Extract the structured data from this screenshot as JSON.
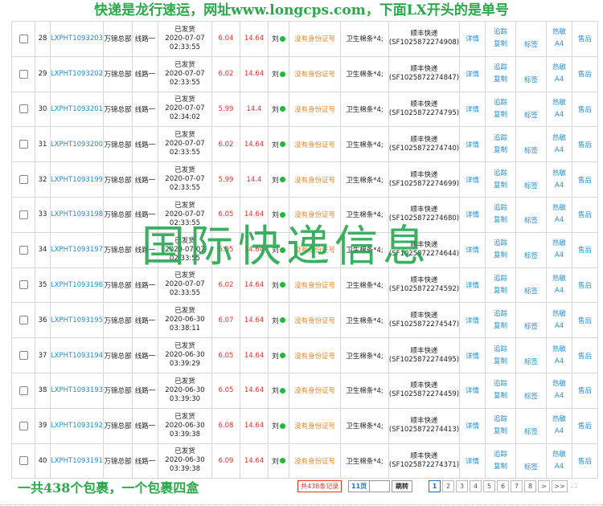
{
  "banner": "快递是龙行速运，网址www.longcps.com，下面LX开头的是单号",
  "watermark": "国际快递信息",
  "rows": [
    {
      "no": "28",
      "order": "LXPHT1093203",
      "dept": "万锦总部",
      "line": "线路一",
      "status": "已发货",
      "date": "2020-07-07",
      "time": "02:33:55",
      "weight": "6.04",
      "fee": "14.64",
      "recv": "刘",
      "id_note": "没有身份证号",
      "goods": "卫生棉条*4;",
      "carrier": "顺丰快递",
      "tracking": "(SF1025872274908)",
      "detail": "详情",
      "track": "追踪",
      "copy": "复制",
      "tag": "标签",
      "printer": "热敏",
      "paper": "A4",
      "after": "售后"
    },
    {
      "no": "29",
      "order": "LXPHT1093202",
      "dept": "万锦总部",
      "line": "线路一",
      "status": "已发货",
      "date": "2020-07-07",
      "time": "02:33:55",
      "weight": "6.02",
      "fee": "14.64",
      "recv": "刘",
      "id_note": "没有身份证号",
      "goods": "卫生棉条*4;",
      "carrier": "顺丰快递",
      "tracking": "(SF1025872274847)",
      "detail": "详情",
      "track": "追踪",
      "copy": "复制",
      "tag": "标签",
      "printer": "热敏",
      "paper": "A4",
      "after": "售后"
    },
    {
      "no": "30",
      "order": "LXPHT1093201",
      "dept": "万锦总部",
      "line": "线路一",
      "status": "已发货",
      "date": "2020-07-07",
      "time": "02:34:02",
      "weight": "5.99",
      "fee": "14.4",
      "recv": "刘",
      "id_note": "没有身份证号",
      "goods": "卫生棉条*4;",
      "carrier": "顺丰快递",
      "tracking": "(SF1025872274795)",
      "detail": "详情",
      "track": "追踪",
      "copy": "复制",
      "tag": "标签",
      "printer": "热敏",
      "paper": "A4",
      "after": "售后"
    },
    {
      "no": "31",
      "order": "LXPHT1093200",
      "dept": "万锦总部",
      "line": "线路一",
      "status": "已发货",
      "date": "2020-07-07",
      "time": "02:33:55",
      "weight": "6.02",
      "fee": "14.64",
      "recv": "刘",
      "id_note": "没有身份证号",
      "goods": "卫生棉条*4;",
      "carrier": "顺丰快递",
      "tracking": "(SF1025872274740)",
      "detail": "详情",
      "track": "追踪",
      "copy": "复制",
      "tag": "标签",
      "printer": "热敏",
      "paper": "A4",
      "after": "售后"
    },
    {
      "no": "32",
      "order": "LXPHT1093199",
      "dept": "万锦总部",
      "line": "线路一",
      "status": "已发货",
      "date": "2020-07-07",
      "time": "02:33:55",
      "weight": "5.99",
      "fee": "14.4",
      "recv": "刘",
      "id_note": "没有身份证号",
      "goods": "卫生棉条*4;",
      "carrier": "顺丰快递",
      "tracking": "(SF1025872274699)",
      "detail": "详情",
      "track": "追踪",
      "copy": "复制",
      "tag": "标签",
      "printer": "热敏",
      "paper": "A4",
      "after": "售后"
    },
    {
      "no": "33",
      "order": "LXPHT1093198",
      "dept": "万锦总部",
      "line": "线路一",
      "status": "已发货",
      "date": "2020-07-07",
      "time": "02:33:55",
      "weight": "6.05",
      "fee": "14.64",
      "recv": "刘",
      "id_note": "没有身份证号",
      "goods": "卫生棉条*4;",
      "carrier": "顺丰快递",
      "tracking": "(SF1025872274680)",
      "detail": "详情",
      "track": "追踪",
      "copy": "复制",
      "tag": "标签",
      "printer": "热敏",
      "paper": "A4",
      "after": "售后"
    },
    {
      "no": "34",
      "order": "LXPHT1093197",
      "dept": "万锦总部",
      "line": "线路一",
      "status": "已发货",
      "date": "2020-07-07",
      "time": "02:33:55",
      "weight": "6.05",
      "fee": "14.64",
      "recv": "刘",
      "id_note": "没有身份证号",
      "goods": "卫生棉条*4;",
      "carrier": "顺丰快递",
      "tracking": "(SF1025872274644)",
      "detail": "详情",
      "track": "追踪",
      "copy": "复制",
      "tag": "标签",
      "printer": "热敏",
      "paper": "A4",
      "after": "售后"
    },
    {
      "no": "35",
      "order": "LXPHT1093196",
      "dept": "万锦总部",
      "line": "线路一",
      "status": "已发货",
      "date": "2020-07-07",
      "time": "02:33:55",
      "weight": "6.02",
      "fee": "14.64",
      "recv": "刘",
      "id_note": "没有身份证号",
      "goods": "卫生棉条*4;",
      "carrier": "顺丰快递",
      "tracking": "(SF1025872274592)",
      "detail": "详情",
      "track": "追踪",
      "copy": "复制",
      "tag": "标签",
      "printer": "热敏",
      "paper": "A4",
      "after": "售后"
    },
    {
      "no": "36",
      "order": "LXPHT1093195",
      "dept": "万锦总部",
      "line": "线路一",
      "status": "已发货",
      "date": "2020-06-30",
      "time": "03:38:11",
      "weight": "6.07",
      "fee": "14.64",
      "recv": "刘",
      "id_note": "没有身份证号",
      "goods": "卫生棉条*4;",
      "carrier": "顺丰快递",
      "tracking": "(SF1025872274547)",
      "detail": "详情",
      "track": "追踪",
      "copy": "复制",
      "tag": "标签",
      "printer": "热敏",
      "paper": "A4",
      "after": "售后"
    },
    {
      "no": "37",
      "order": "LXPHT1093194",
      "dept": "万锦总部",
      "line": "线路一",
      "status": "已发货",
      "date": "2020-06-30",
      "time": "03:39:29",
      "weight": "6.05",
      "fee": "14.64",
      "recv": "刘",
      "id_note": "没有身份证号",
      "goods": "卫生棉条*4;",
      "carrier": "顺丰快递",
      "tracking": "(SF1025872274495)",
      "detail": "详情",
      "track": "追踪",
      "copy": "复制",
      "tag": "标签",
      "printer": "热敏",
      "paper": "A4",
      "after": "售后"
    },
    {
      "no": "38",
      "order": "LXPHT1093193",
      "dept": "万锦总部",
      "line": "线路一",
      "status": "已发货",
      "date": "2020-06-30",
      "time": "03:39:30",
      "weight": "6.05",
      "fee": "14.64",
      "recv": "刘",
      "id_note": "没有身份证号",
      "goods": "卫生棉条*4;",
      "carrier": "顺丰快递",
      "tracking": "(SF1025872274459)",
      "detail": "详情",
      "track": "追踪",
      "copy": "复制",
      "tag": "标签",
      "printer": "热敏",
      "paper": "A4",
      "after": "售后"
    },
    {
      "no": "39",
      "order": "LXPHT1093192",
      "dept": "万锦总部",
      "line": "线路一",
      "status": "已发货",
      "date": "2020-06-30",
      "time": "03:39:38",
      "weight": "6.08",
      "fee": "14.64",
      "recv": "刘",
      "id_note": "没有身份证号",
      "goods": "卫生棉条*4;",
      "carrier": "顺丰快递",
      "tracking": "(SF1025872274413)",
      "detail": "详情",
      "track": "追踪",
      "copy": "复制",
      "tag": "标签",
      "printer": "热敏",
      "paper": "A4",
      "after": "售后"
    },
    {
      "no": "40",
      "order": "LXPHT1093191",
      "dept": "万锦总部",
      "line": "线路一",
      "status": "已发货",
      "date": "2020-06-30",
      "time": "03:39:38",
      "weight": "6.09",
      "fee": "14.64",
      "recv": "刘",
      "id_note": "没有身份证号",
      "goods": "卫生棉条*4;",
      "carrier": "顺丰快递",
      "tracking": "(SF1025872274371)",
      "detail": "详情",
      "track": "追踪",
      "copy": "复制",
      "tag": "标签",
      "printer": "热敏",
      "paper": "A4",
      "after": "售后"
    }
  ],
  "footer": {
    "note": "一共438个包裹，一个包裹四盒",
    "total": "共438条记录",
    "per_page": "11页",
    "jump": "跳转",
    "pages": [
      "1",
      "2",
      "3",
      "4",
      "5",
      "6",
      "7",
      "8"
    ],
    "current_page": "1",
    "next": ">",
    "last": ">>",
    "trail": ". ."
  },
  "colors": {
    "banner": "#2aa84a",
    "link": "#1f8fd6",
    "weight_red": "#e8312a",
    "id_orange": "#f0841c",
    "status_dot": "#1cba3a",
    "watermark": "#1fa64c"
  }
}
